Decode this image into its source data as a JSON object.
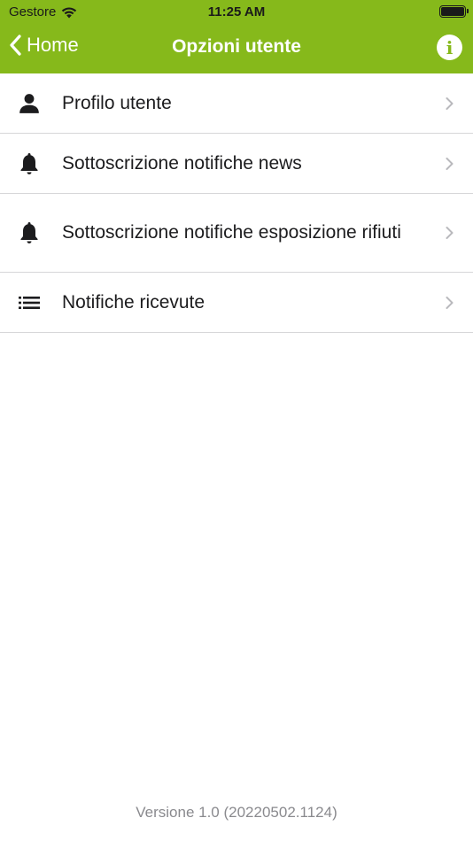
{
  "status_bar": {
    "carrier": "Gestore",
    "time": "11:25 AM"
  },
  "nav": {
    "back_label": "Home",
    "title": "Opzioni utente",
    "info_glyph": "i"
  },
  "menu": [
    {
      "label": "Profilo utente",
      "icon": "person-icon"
    },
    {
      "label": "Sottoscrizione notifiche news",
      "icon": "bell-icon"
    },
    {
      "label": "Sottoscrizione notifiche esposizione rifiuti",
      "icon": "bell-icon"
    },
    {
      "label": "Notifiche ricevute",
      "icon": "list-icon"
    }
  ],
  "footer": {
    "version": "Versione 1.0 (20220502.1124)"
  },
  "colors": {
    "accent": "#86b91b",
    "separator": "#d6d6d8",
    "chevron": "#b9b9bd",
    "muted": "#8a8a8e"
  }
}
